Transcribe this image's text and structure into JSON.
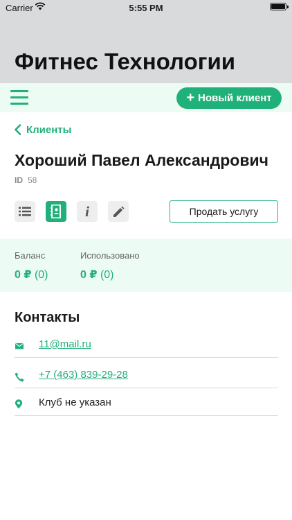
{
  "status_bar": {
    "carrier": "Carrier",
    "time": "5:55 PM"
  },
  "app": {
    "title": "Фитнес Технологии"
  },
  "toolbar": {
    "new_client_label": "Новый клиент",
    "plus": "+"
  },
  "nav": {
    "back_label": "Клиенты"
  },
  "client": {
    "name": "Хороший Павел Александрович",
    "id_label": "ID",
    "id_value": "58"
  },
  "actions": {
    "sell_label": "Продать услугу",
    "tabs": [
      "list-icon",
      "contact-card-icon",
      "info-icon",
      "edit-pencil-icon"
    ],
    "active_tab": 1,
    "info_glyph": "i"
  },
  "balance": {
    "label": "Баланс",
    "amount": "0 ₽",
    "extra": "(0)"
  },
  "used": {
    "label": "Использовано",
    "amount": "0 ₽",
    "extra": "(0)"
  },
  "contacts": {
    "title": "Контакты",
    "email": "11@mail.ru",
    "phone": "+7 (463) 839-29-28",
    "club": "Клуб не указан"
  },
  "colors": {
    "accent": "#20b07a",
    "header_bg": "#d8dadb",
    "panel_bg": "#ecfbf4"
  }
}
